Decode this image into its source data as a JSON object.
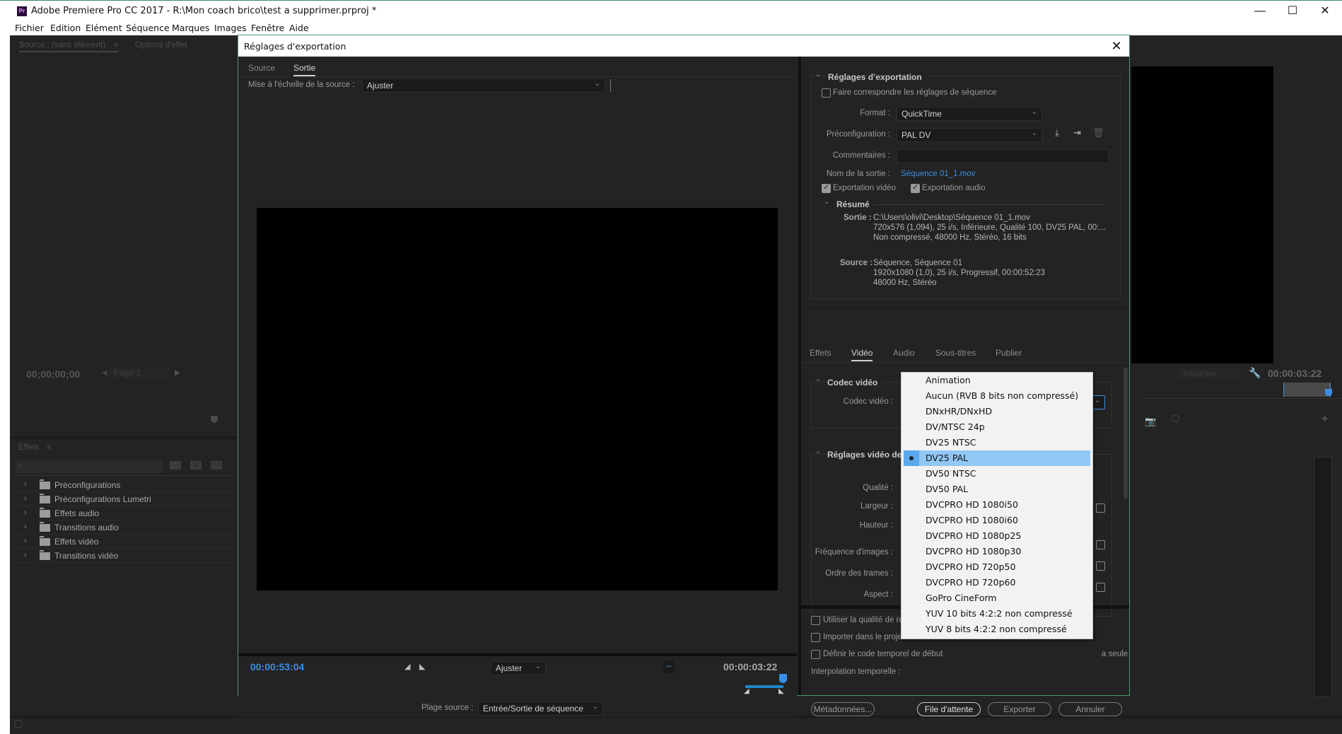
{
  "window": {
    "title": "Adobe Premiere Pro CC 2017 - R:\\Mon coach brico\\test a supprimer.prproj *",
    "app_icon_label": "Pr",
    "minimize_label": "—",
    "maximize_label": "☐",
    "close_label": "✕"
  },
  "menu": [
    "Fichier",
    "Edition",
    "Elément",
    "Séquence",
    "Marques",
    "Images",
    "Fenêtre",
    "Aide"
  ],
  "background_app": {
    "source_tab": "Source : (sans élément)",
    "source_menu_icon": "≡",
    "effect_options_tab": "Options d'effet",
    "source_timecode": "00;00;00;00",
    "page_select": "Page 1",
    "effects_tab": "Effets",
    "effects_menu_icon": "≡",
    "effects_tree": [
      {
        "label": "Préconfigurations",
        "icon": "folder-star-icon"
      },
      {
        "label": "Préconfigurations Lumetri",
        "icon": "folder-star-icon"
      },
      {
        "label": "Effets audio",
        "icon": "folder-icon"
      },
      {
        "label": "Transitions audio",
        "icon": "folder-icon"
      },
      {
        "label": "Effets vidéo",
        "icon": "folder-icon"
      },
      {
        "label": "Transitions vidéo",
        "icon": "folder-icon"
      }
    ],
    "effect_filter_badges": [
      "32",
      "YUV"
    ],
    "program_zoom": "Intégrale",
    "program_timecode": "00:00:03:22"
  },
  "dialog": {
    "title": "Réglages d'exportation",
    "close_label": "✕",
    "left": {
      "tabs": [
        {
          "label": "Source",
          "active": false
        },
        {
          "label": "Sortie",
          "active": true
        }
      ],
      "scale_label": "Mise à l'échelle de la source :",
      "scale_value": "Ajuster",
      "current_timecode": "00:00:53:04",
      "zoom_value": "Ajuster",
      "duration_timecode": "00:00:03:22",
      "source_range_label": "Plage source :",
      "source_range_value": "Entrée/Sortie de séquence"
    },
    "right": {
      "export_settings": {
        "title": "Réglages d’exportation",
        "match_sequence_label": "Faire correspondre les réglages de séquence",
        "match_sequence_checked": false,
        "format_label": "Format :",
        "format_value": "QuickTime",
        "preset_label": "Préconfiguration :",
        "preset_value": "PAL DV",
        "comments_label": "Commentaires :",
        "comments_value": "",
        "output_name_label": "Nom de la sortie :",
        "output_name_value": "Séquence 01_1.mov",
        "export_video_label": "Exportation vidéo",
        "export_video_checked": true,
        "export_audio_label": "Exportation audio",
        "export_audio_checked": true
      },
      "summary": {
        "title": "Résumé",
        "output_label": "Sortie :",
        "output_lines": [
          "C:\\Users\\olivi\\Desktop\\Séquence 01_1.mov",
          "720x576 (1,094), 25 i/s, Inférieure, Qualité  100, DV25 PAL, 00:...",
          "Non compressé, 48000  Hz, Stéréo, 16 bits"
        ],
        "source_label": "Source :",
        "source_lines": [
          "Séquence, Séquence 01",
          "1920x1080 (1,0), 25  i/s, Progressif, 00:00:52:23",
          "48000 Hz, Stéréo"
        ]
      },
      "tabs": [
        {
          "label": "Effets",
          "active": false
        },
        {
          "label": "Vidéo",
          "active": true
        },
        {
          "label": "Audio",
          "active": false
        },
        {
          "label": "Sous-titres",
          "active": false
        },
        {
          "label": "Publier",
          "active": false
        }
      ],
      "video_codec": {
        "title": "Codec vidéo",
        "codec_label": "Codec vidéo :",
        "codec_value": "DV25 PAL"
      },
      "basic_video": {
        "title": "Réglages vidéo de base",
        "fields": [
          "Qualité :",
          "Largeur :",
          "Hauteur :",
          "Fréquence d'images :",
          "Ordre des trames :",
          "Aspect :"
        ]
      },
      "bottom_options": [
        {
          "label": "Utiliser la qualité de rendu maximale",
          "checked": false
        },
        {
          "label": "Importer dans le projet",
          "checked": false
        },
        {
          "label": "Définir le code temporel de début",
          "checked": false,
          "trailing": "a seule"
        }
      ],
      "interpolation_label": "Interpolation temporelle :",
      "buttons": {
        "metadata": "Métadonnées...",
        "queue": "File d'attente",
        "export": "Exporter",
        "cancel": "Annuler"
      }
    },
    "codec_dropdown": {
      "selected": "DV25 PAL",
      "options": [
        "Animation",
        "Aucun (RVB 8 bits non compressé)",
        "DNxHR/DNxHD",
        "DV/NTSC 24p",
        "DV25 NTSC",
        "DV25 PAL",
        "DV50 NTSC",
        "DV50 PAL",
        "DVCPRO HD 1080i50",
        "DVCPRO HD 1080i60",
        "DVCPRO HD 1080p25",
        "DVCPRO HD 1080p30",
        "DVCPRO HD 720p50",
        "DVCPRO HD 720p60",
        "GoPro CineForm",
        "YUV 10 bits 4:2:2 non compressé",
        "YUV 8 bits 4:2:2 non compressé"
      ]
    }
  },
  "colors": {
    "accent_blue": "#3a8ee6",
    "link_blue": "#3d8fe0",
    "selection": "#91c7f5",
    "dialog_border": "#4b9a6a"
  }
}
